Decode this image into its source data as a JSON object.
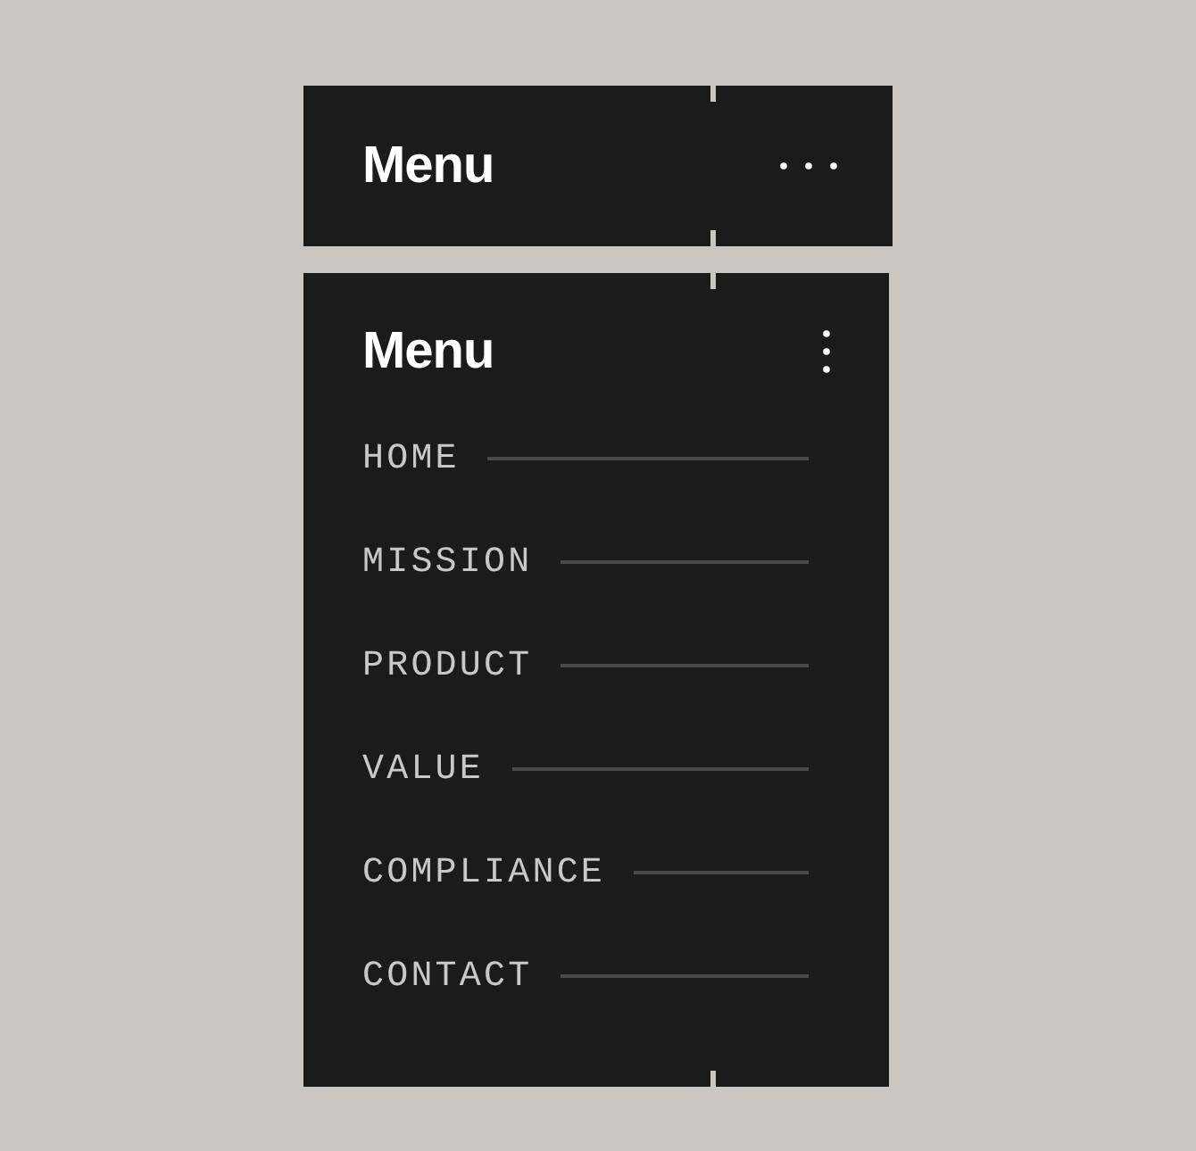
{
  "panels": [
    {
      "title": "Menu",
      "expanded": false
    },
    {
      "title": "Menu",
      "expanded": true,
      "items": [
        {
          "label": "HOME"
        },
        {
          "label": "MISSION"
        },
        {
          "label": "PRODUCT"
        },
        {
          "label": "VALUE"
        },
        {
          "label": "COMPLIANCE"
        },
        {
          "label": "CONTACT"
        }
      ]
    }
  ]
}
